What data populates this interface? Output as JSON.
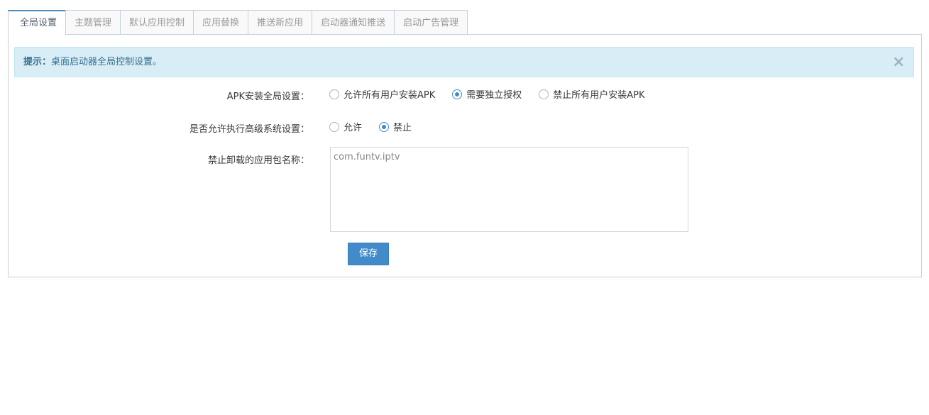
{
  "tabs": [
    {
      "label": "全局设置",
      "active": true
    },
    {
      "label": "主题管理",
      "active": false
    },
    {
      "label": "默认应用控制",
      "active": false
    },
    {
      "label": "应用替换",
      "active": false
    },
    {
      "label": "推送新应用",
      "active": false
    },
    {
      "label": "启动器通知推送",
      "active": false
    },
    {
      "label": "启动广告管理",
      "active": false
    }
  ],
  "alert": {
    "strong": "提示：",
    "text": "桌面启动器全局控制设置。",
    "close_glyph": "×"
  },
  "apk_setting": {
    "label": "APK安装全局设置：",
    "options": [
      {
        "label": "允许所有用户安装APK",
        "checked": false
      },
      {
        "label": "需要独立授权",
        "checked": true
      },
      {
        "label": "禁止所有用户安装APK",
        "checked": false
      }
    ]
  },
  "advanced_setting": {
    "label": "是否允许执行高级系统设置：",
    "options": [
      {
        "label": "允许",
        "checked": false
      },
      {
        "label": "禁止",
        "checked": true
      }
    ]
  },
  "uninstall_block": {
    "label": "禁止卸载的应用包名称：",
    "value": "com.funtv.iptv"
  },
  "save_button": {
    "label": "保存"
  },
  "colors": {
    "accent": "#428bca",
    "alert_bg": "#d9edf7",
    "alert_text": "#31708f",
    "tab_border": "#c5d0dc"
  }
}
